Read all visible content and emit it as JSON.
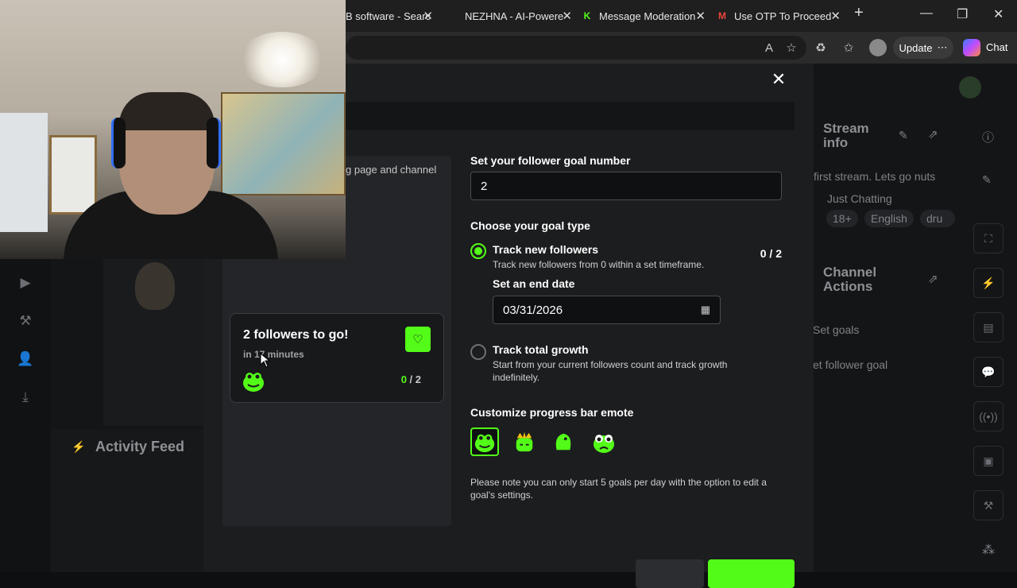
{
  "browser": {
    "tabs": [
      {
        "label": "B software - Searc",
        "fav": ""
      },
      {
        "label": "NEZHNA - AI-Powere",
        "fav": ""
      },
      {
        "label": "Message Moderation",
        "fav": "K"
      },
      {
        "label": "Use OTP To Proceed",
        "fav": "M"
      }
    ],
    "update_label": "Update",
    "chat_label": "Chat"
  },
  "background": {
    "stream_info_title": "Stream info",
    "stream_title_frag": "first stream. Lets go nuts",
    "category": "Just Chatting",
    "tags": [
      "18+",
      "English",
      "dru"
    ],
    "channel_actions_title": "Channel Actions",
    "actions": [
      "Set goals",
      "et follower goal"
    ],
    "activity_feed_title": "Activity Feed"
  },
  "modal": {
    "description_fragment": "g page and channel",
    "preview_card": {
      "title": "2 followers to go!",
      "subtitle": "in 17 minutes",
      "current": "0",
      "sep": " / ",
      "total": "2"
    },
    "goal_number_label": "Set your follower goal number",
    "goal_number_value": "2",
    "goal_type_label": "Choose your goal type",
    "option_new": {
      "label": "Track new followers",
      "description": "Track new followers from 0 within a set timeframe.",
      "progress": "0 / 2"
    },
    "end_date_label": "Set an end date",
    "end_date_value": "03/31/2026",
    "option_total": {
      "label": "Track total growth",
      "description": "Start from your current followers count and track growth indefinitely."
    },
    "emote_label": "Customize progress bar emote",
    "note": "Please note you can only start 5 goals per day with the option to edit a goal's settings.",
    "accent_color": "#53fc18"
  }
}
